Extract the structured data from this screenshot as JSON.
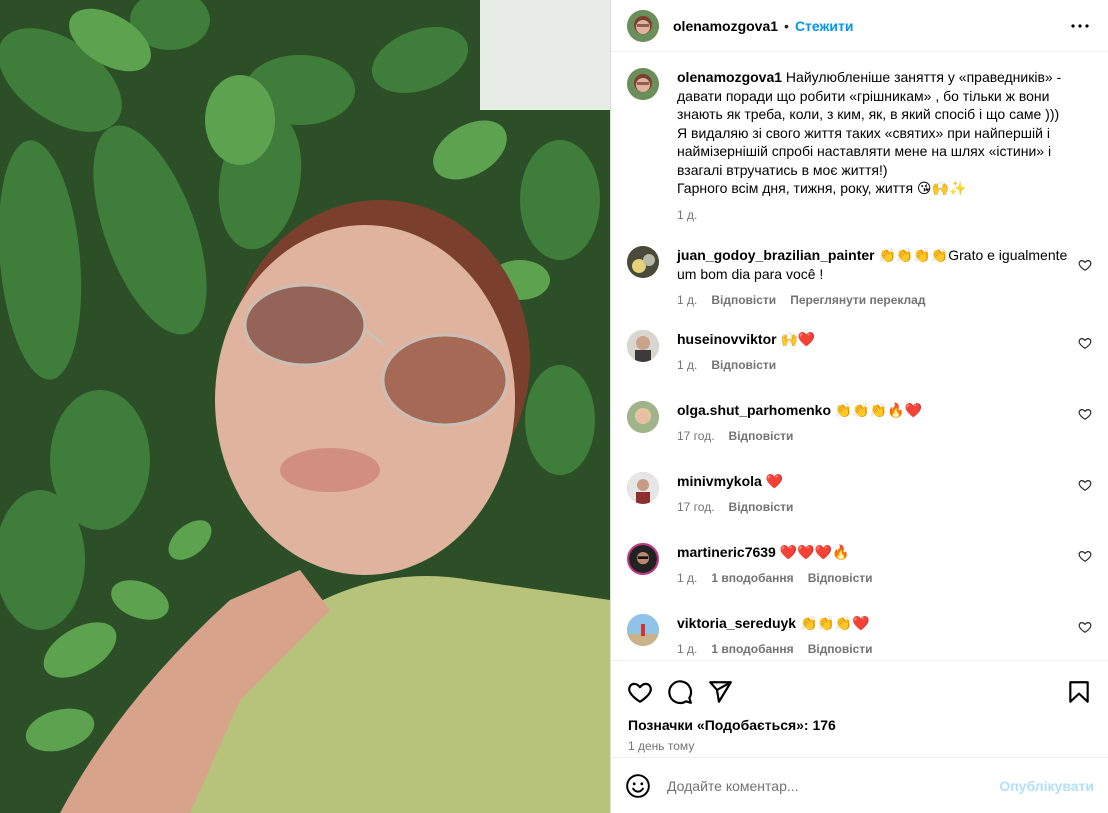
{
  "post": {
    "author": "olenamozgova1",
    "follow_label": "Стежити",
    "separator": "•",
    "caption_lines": [
      "Найулюбленіше заняття у «праведників» -",
      "давати поради що робити «грішникам» , бо тільки ж вони",
      "знають як треба, коли, з ким, як, в який спосіб і що саме )))",
      "Я видаляю зі свого життя таких «святих» при найпершій і",
      "наймізернішій спробі наставляти мене на шлях «істини» і",
      "взагалі втручатись в моє життя!)",
      "Гарного всім дня, тижня, року, життя 😘🙌✨"
    ],
    "caption_time": "1 д."
  },
  "comments": [
    {
      "user": "juan_godoy_brazilian_painter",
      "text": "👏👏👏👏Grato e igualmente um bom dia para você !",
      "time": "1 д.",
      "likes": "",
      "reply": "Відповісти",
      "translate": "Переглянути переклад"
    },
    {
      "user": "huseinovviktor",
      "text": "🙌❤️",
      "time": "1 д.",
      "likes": "",
      "reply": "Відповісти",
      "translate": ""
    },
    {
      "user": "olga.shut_parhomenko",
      "text": "👏👏👏🔥❤️",
      "time": "17 год.",
      "likes": "",
      "reply": "Відповісти",
      "translate": ""
    },
    {
      "user": "minivmykola",
      "text": "❤️",
      "time": "17 год.",
      "likes": "",
      "reply": "Відповісти",
      "translate": ""
    },
    {
      "user": "martineric7639",
      "text": "❤️❤️❤️🔥",
      "time": "1 д.",
      "likes": "1 вподобання",
      "reply": "Відповісти",
      "translate": ""
    },
    {
      "user": "viktoria_sereduyk",
      "text": "👏👏👏❤️",
      "time": "1 д.",
      "likes": "1 вподобання",
      "reply": "Відповісти",
      "translate": ""
    }
  ],
  "footer": {
    "likes_text": "Позначки «Подобається»: 176",
    "date_text": "1 день тому",
    "comment_placeholder": "Додайте коментар...",
    "publish_label": "Опублікувати"
  },
  "colors": {
    "accent": "#0095f6",
    "publish_disabled": "#b2dffc",
    "muted": "#737373",
    "border": "#dbdbdb"
  }
}
